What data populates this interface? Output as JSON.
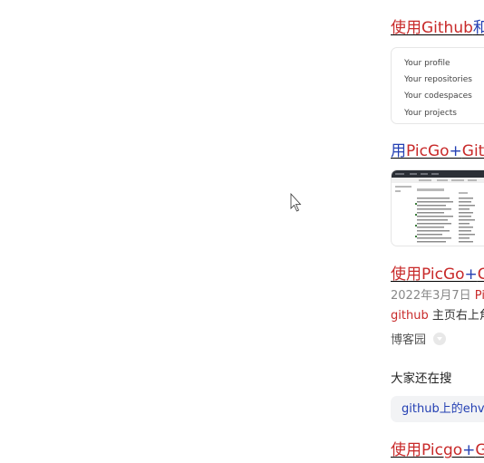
{
  "results": [
    {
      "title_parts": [
        {
          "text": "使用",
          "color": "red"
        },
        {
          "text": "Github",
          "color": "red"
        },
        {
          "text": "和",
          "color": "blue"
        }
      ],
      "thumbnail": {
        "type": "menu",
        "items": [
          "Your profile",
          "Your repositories",
          "Your codespaces",
          "Your projects"
        ]
      }
    },
    {
      "title_parts": [
        {
          "text": "用",
          "color": "blue"
        },
        {
          "text": "PicGo",
          "color": "red"
        },
        {
          "text": "+",
          "color": "blue"
        },
        {
          "text": "Gitl",
          "color": "red"
        }
      ],
      "thumbnail": {
        "type": "screenshot"
      }
    },
    {
      "title_parts": [
        {
          "text": "使用",
          "color": "red"
        },
        {
          "text": "PicGo",
          "color": "red"
        },
        {
          "text": "+",
          "color": "blue"
        },
        {
          "text": "G",
          "color": "red"
        }
      ],
      "date": "2022年3月7日",
      "date_keyword": "Pic",
      "snippet_keyword": "github",
      "snippet_text": "主页右上角",
      "source": "博客园"
    }
  ],
  "also_search": {
    "title": "大家还在搜",
    "chip": "github上的ehvi"
  },
  "last_result": {
    "title_parts": [
      {
        "text": "使用",
        "color": "red"
      },
      {
        "text": "Picgo",
        "color": "red"
      },
      {
        "text": "+",
        "color": "blue"
      },
      {
        "text": "G",
        "color": "red"
      }
    ]
  },
  "colors": {
    "red": "#c82a2a",
    "blue": "#2440b3"
  }
}
